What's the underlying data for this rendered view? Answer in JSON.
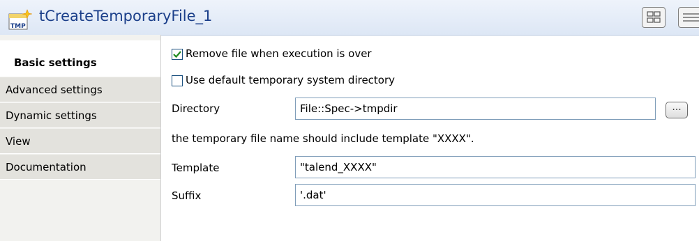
{
  "component": {
    "icon_label": "TMP",
    "title": "tCreateTemporaryFile_1"
  },
  "tabs": [
    {
      "label": "Basic settings",
      "active": true
    },
    {
      "label": "Advanced settings",
      "active": false
    },
    {
      "label": "Dynamic settings",
      "active": false
    },
    {
      "label": "View",
      "active": false
    },
    {
      "label": "Documentation",
      "active": false
    }
  ],
  "basic": {
    "remove_file": {
      "label": "Remove file when execution is over",
      "checked": true
    },
    "use_default_dir": {
      "label": "Use default temporary system directory",
      "checked": false
    },
    "directory": {
      "label": "Directory",
      "value": "File::Spec->tmpdir",
      "browse_label": "..."
    },
    "template_note": "the temporary file name should include template \"XXXX\".",
    "template": {
      "label": "Template",
      "value": "\"talend_XXXX\""
    },
    "suffix": {
      "label": "Suffix",
      "value": "'.dat'"
    }
  },
  "colors": {
    "title_text": "#1b3f8a",
    "check_mark": "#1f8a1f",
    "field_border": "#7f9db9"
  }
}
